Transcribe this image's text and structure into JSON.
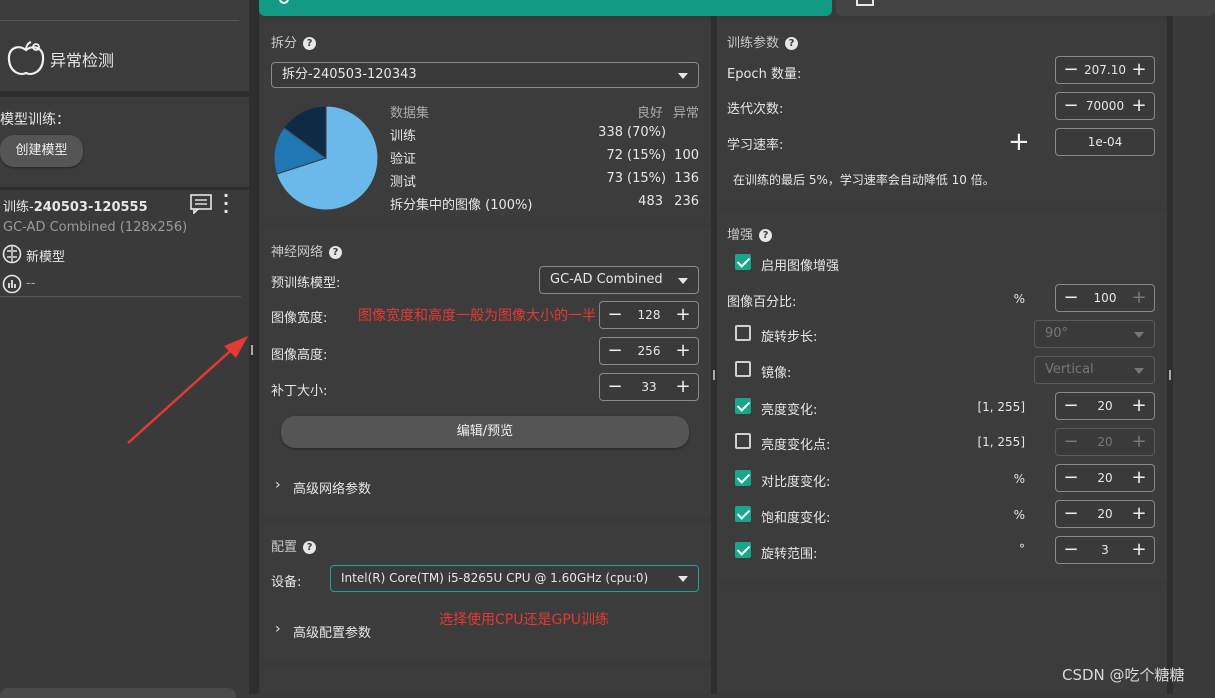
{
  "sidebar": {
    "app_title": "异常检测",
    "model_training_label": "模型训练：",
    "create_model_button": "创建模型",
    "training": {
      "name_prefix": "训练-",
      "name_id": "240503-120555",
      "model_desc": "GC-AD Combined (128x256)",
      "new_model_label": "新模型",
      "metric_value": "--"
    }
  },
  "split": {
    "title": "拆分",
    "selected": "拆分-240503-120343",
    "headers": {
      "dataset": "数据集",
      "good": "良好",
      "anomaly": "异常"
    },
    "rows": [
      {
        "name": "训练",
        "good": "338",
        "good_pct": "(70%)",
        "anomaly": ""
      },
      {
        "name": "验证",
        "good": "72",
        "good_pct": "(15%)",
        "anomaly": "100"
      },
      {
        "name": "测试",
        "good": "73",
        "good_pct": "(15%)",
        "anomaly": "136"
      },
      {
        "name": "拆分集中的图像",
        "name_pct": "(100%)",
        "good": "483",
        "good_pct": "",
        "anomaly": "236"
      }
    ],
    "pie": {
      "slices": [
        {
          "label": "训练",
          "value": 70,
          "color": "#6ab9e8"
        },
        {
          "label": "验证",
          "value": 15,
          "color": "#1f78b4"
        },
        {
          "label": "测试",
          "value": 15,
          "color": "#0e2a44"
        }
      ]
    }
  },
  "network": {
    "title": "神经网络",
    "pretrained_label": "预训练模型:",
    "pretrained_value": "GC-AD Combined",
    "image_width_label": "图像宽度:",
    "image_width": "128",
    "image_height_label": "图像高度:",
    "image_height": "256",
    "patch_size_label": "补丁大小:",
    "patch_size": "33",
    "edit_preview_button": "编辑/预览",
    "advanced_label": "高级网络参数",
    "note": "图像宽度和高度一般为图像大小的一半"
  },
  "config": {
    "title": "配置",
    "device_label": "设备:",
    "device_value": "Intel(R) Core(TM) i5-8265U CPU @ 1.60GHz (cpu:0)",
    "advanced_label": "高级配置参数",
    "note": "选择使用CPU还是GPU训练"
  },
  "train_params": {
    "title": "训练参数",
    "epoch_label": "Epoch 数量:",
    "epoch_value": "207.10",
    "iter_label": "迭代次数:",
    "iter_value": "70000",
    "lr_label": "学习速率:",
    "lr_value": "1e-04",
    "lr_note": "在训练的最后 5%，学习速率会自动降低 10 倍。"
  },
  "augment": {
    "title": "增强",
    "enable_label": "启用图像增强",
    "image_percent_label": "图像百分比:",
    "image_percent_unit": "%",
    "image_percent_value": "100",
    "rotation_step_label": "旋转步长:",
    "rotation_step_value": "90°",
    "mirror_label": "镜像:",
    "mirror_value": "Vertical",
    "brightness_label": "亮度变化:",
    "brightness_unit": "[1, 255]",
    "brightness_value": "20",
    "brightness_point_label": "亮度变化点:",
    "brightness_point_unit": "[1, 255]",
    "brightness_point_value": "20",
    "contrast_label": "对比度变化:",
    "contrast_unit": "%",
    "contrast_value": "20",
    "saturation_label": "饱和度变化:",
    "saturation_unit": "%",
    "saturation_value": "20",
    "rotation_range_label": "旋转范围:",
    "rotation_range_unit": "°",
    "rotation_range_value": "3"
  },
  "watermark": "CSDN @吃个糖糖",
  "colors": {
    "accent": "#1aa58e",
    "annotation_red": "#e53935",
    "panel": "#3c3c3c"
  }
}
